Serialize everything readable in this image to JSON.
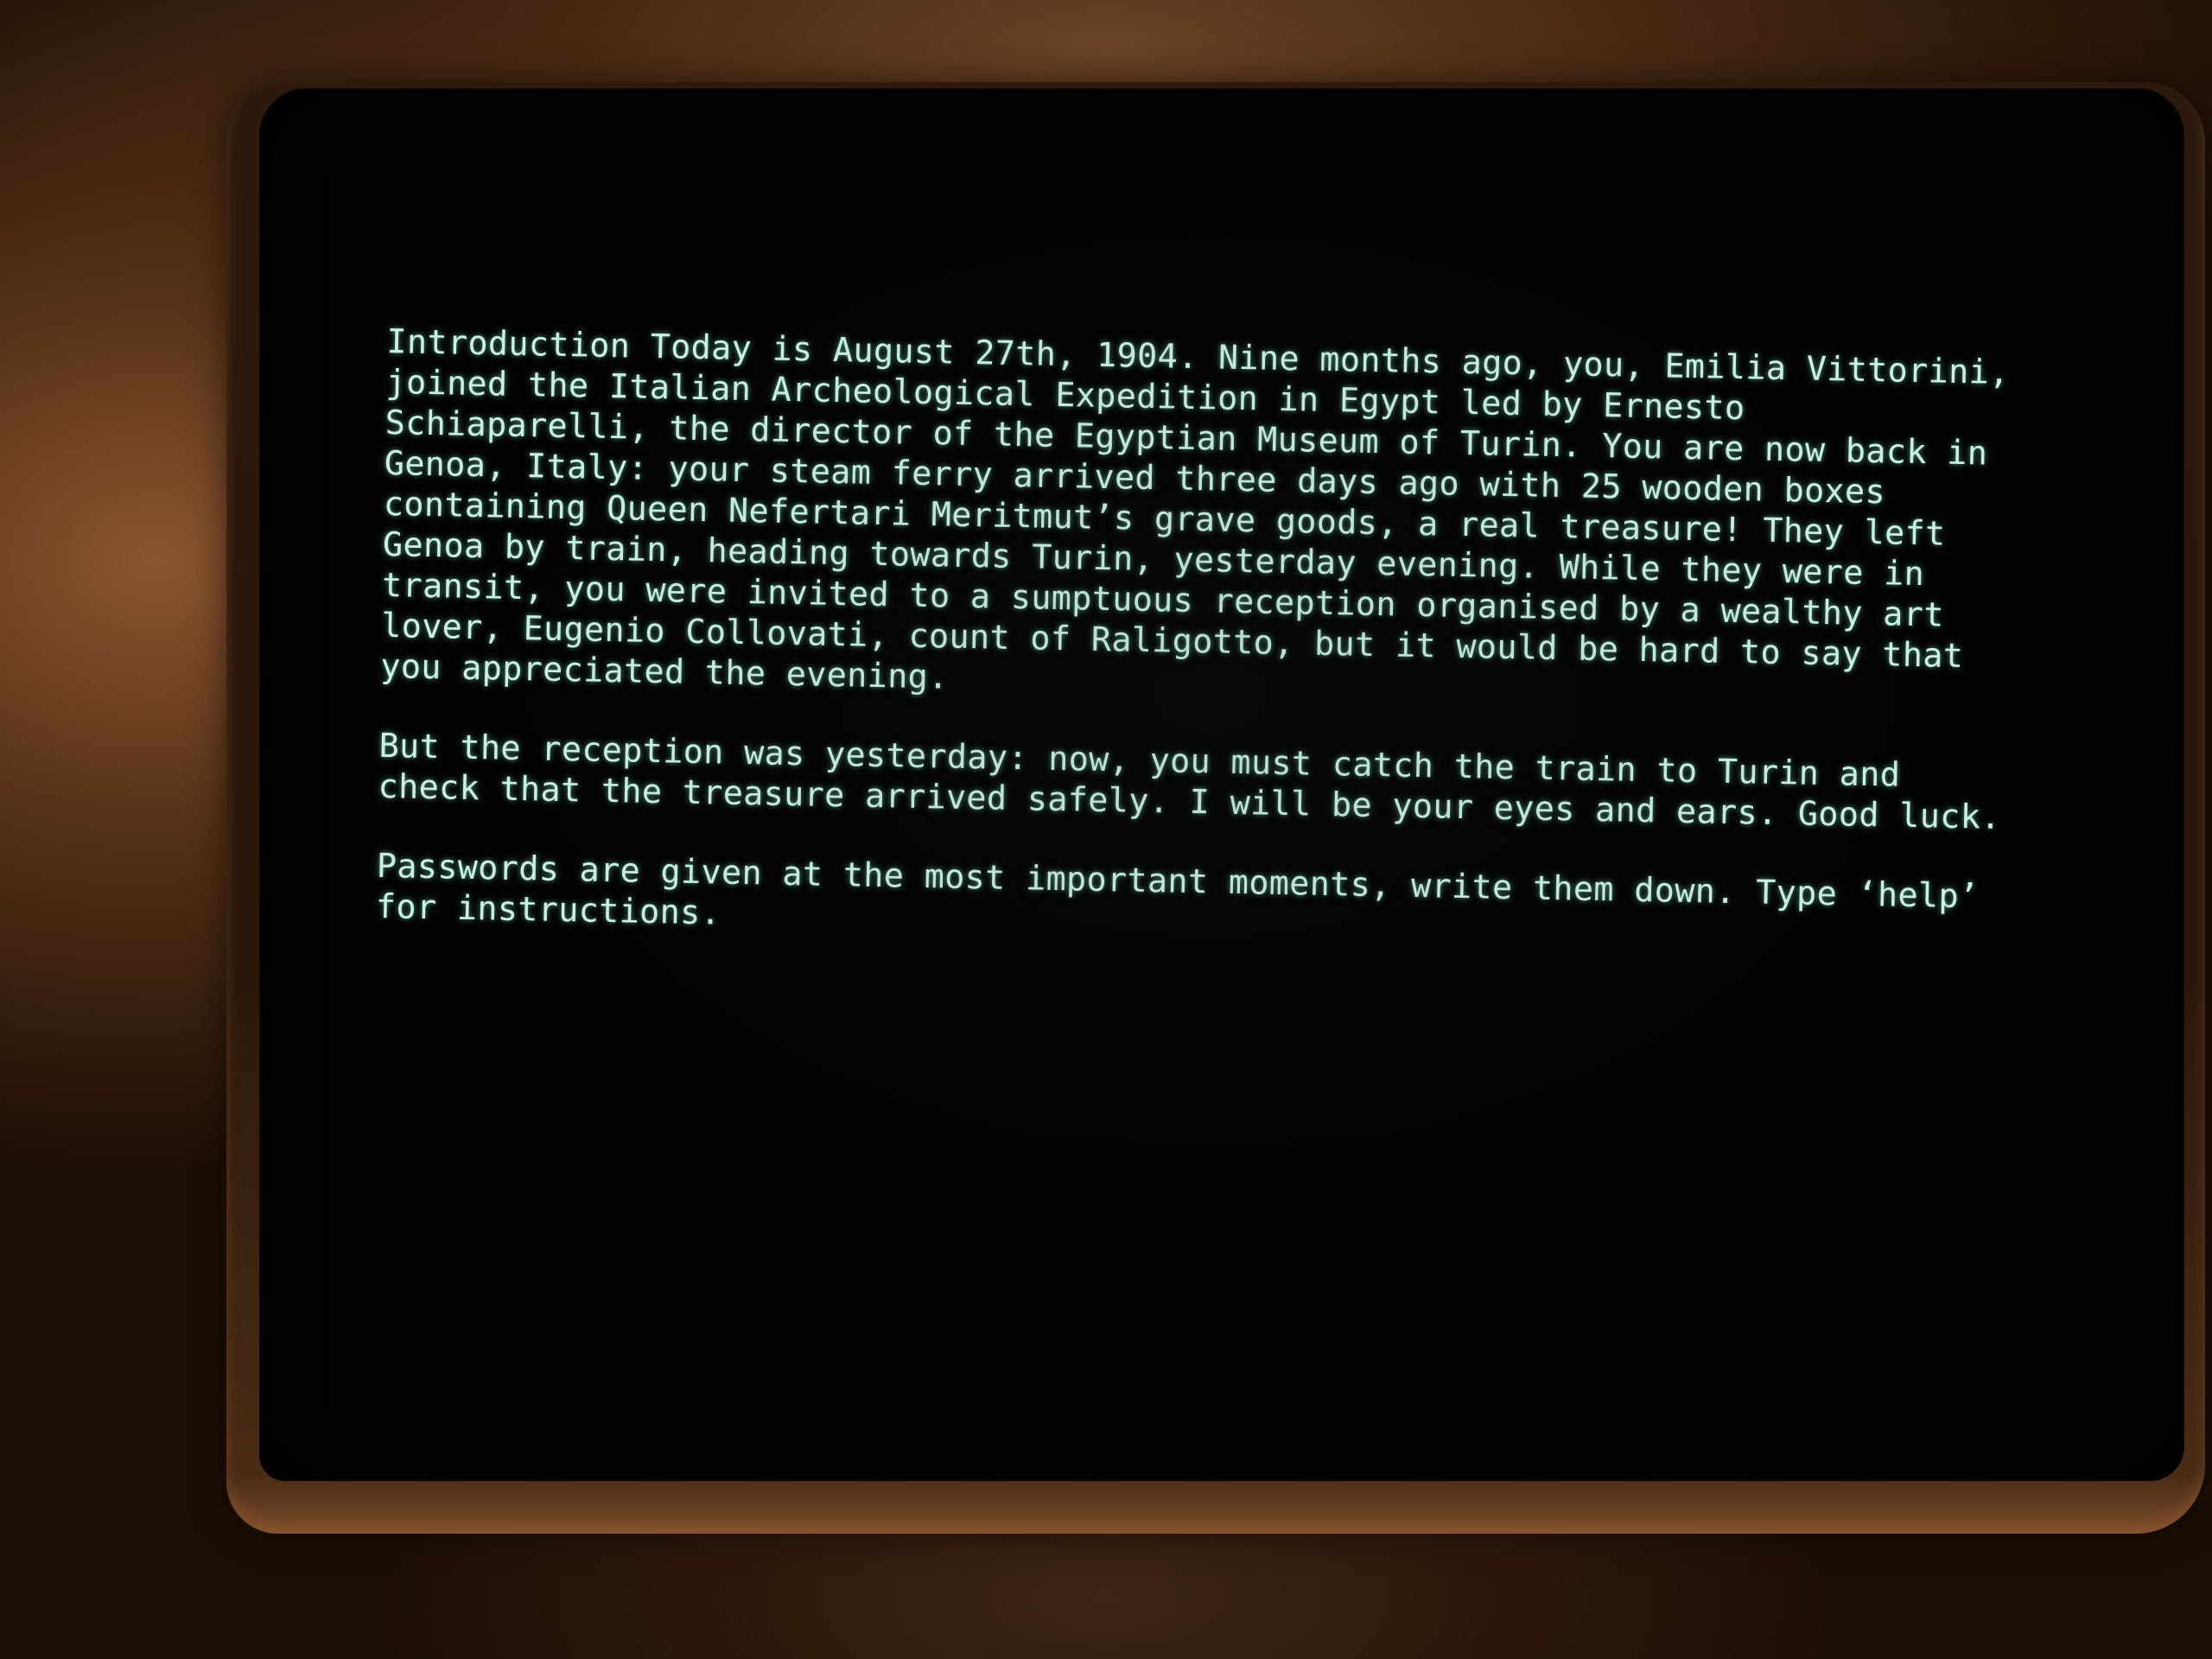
{
  "terminal": {
    "intro_paragraph": "Introduction  Today is August 27th, 1904. Nine months ago, you, Emilia Vittorini, joined the Italian Archeological Expedition in Egypt led by Ernesto Schiaparelli, the director of the Egyptian Museum of Turin. You are now back in Genoa, Italy: your steam ferry arrived three days ago with 25 wooden boxes containing Queen Nefertari Meritmut’s grave goods, a real treasure! They left Genoa by train, heading towards Turin, yesterday evening. While they were in transit, you were invited to a sumptuous reception organised by a wealthy art lover, Eugenio Collovati, count of Raligotto, but it would be hard to say that you appreciated the evening.",
    "second_paragraph": "But the reception was yesterday: now, you must catch the train to Turin and check that the treasure arrived safely. I will be your eyes and ears. Good luck.",
    "third_paragraph": "Passwords are given at the most important moments, write them down. Type ‘help’ for instructions.",
    "text_color": "#c8f1e1",
    "screen_color": "#040303"
  }
}
